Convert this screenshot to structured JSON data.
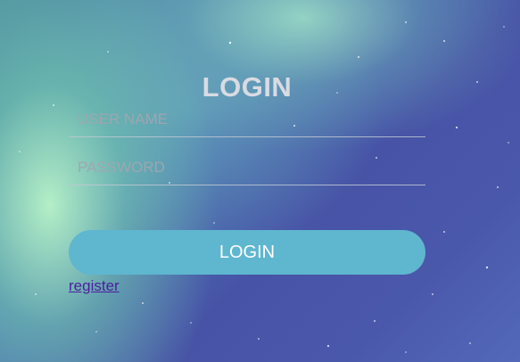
{
  "form": {
    "title": "LOGIN",
    "username_placeholder": "USER NAME",
    "username_value": "",
    "password_placeholder": "PASSWORD",
    "password_value": "",
    "login_button_label": "LOGIN",
    "register_link_label": "register"
  },
  "colors": {
    "button_background": "#5fb6cf",
    "link": "#4b1f9e"
  }
}
